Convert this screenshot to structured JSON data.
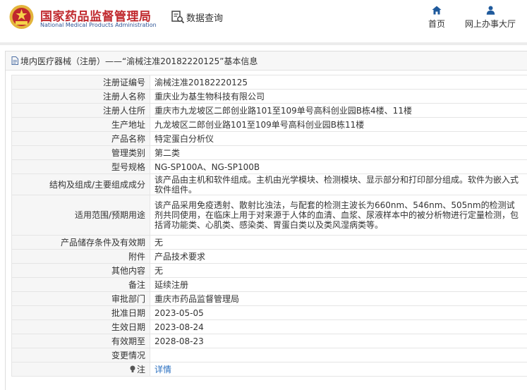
{
  "header": {
    "site_title": "国家药品监督管理局",
    "site_subtitle": "National Medical Products Administration",
    "query_label": "数据查询",
    "nav_home": "首页",
    "nav_online": "网上办事大厅"
  },
  "panel": {
    "title": "境内医疗器械（注册）——“渝械注准20182220125”基本信息"
  },
  "rows": [
    {
      "label": "注册证编号",
      "value": "渝械注准20182220125"
    },
    {
      "label": "注册人名称",
      "value": "重庆业为基生物科技有限公司"
    },
    {
      "label": "注册人住所",
      "value": "重庆市九龙坡区二郎创业路101至109单号高科创业园B栋4楼、11楼"
    },
    {
      "label": "生产地址",
      "value": "九龙坡区二郎创业路101至109单号高科创业园B栋11楼"
    },
    {
      "label": "产品名称",
      "value": "特定蛋白分析仪"
    },
    {
      "label": "管理类别",
      "value": "第二类"
    },
    {
      "label": "型号规格",
      "value": "NG-SP100A、NG-SP100B"
    },
    {
      "label": "结构及组成/主要组成成分",
      "value": "该产品由主机和软件组成。主机由光学模块、检测模块、显示部分和打印部分组成。软件为嵌入式软件组件。"
    },
    {
      "label": "适用范围/预期用途",
      "value": "该产品采用免疫透射、散射比浊法，与配套的检测主波长为660nm、546nm、505nm的检测试剂共同使用，在临床上用于对来源于人体的血清、血浆、尿液样本中的被分析物进行定量检测，包括肾功能类、心肌类、感染类、胃蛋白类以及类风湿病类等。"
    },
    {
      "label": "产品储存条件及有效期",
      "value": "无"
    },
    {
      "label": "附件",
      "value": "产品技术要求"
    },
    {
      "label": "其他内容",
      "value": "无"
    },
    {
      "label": "备注",
      "value": "延续注册"
    },
    {
      "label": "审批部门",
      "value": "重庆市药品监督管理局"
    },
    {
      "label": "批准日期",
      "value": "2023-05-05"
    },
    {
      "label": "生效日期",
      "value": "2023-08-24"
    },
    {
      "label": "有效期至",
      "value": "2028-08-23"
    },
    {
      "label": "变更情况",
      "value": ""
    }
  ],
  "note_row": {
    "label": "注",
    "value": "详情"
  },
  "colors": {
    "brand_red": "#c0282d",
    "brand_blue": "#2f5597",
    "link_blue": "#2a6fc0",
    "label_bg": "#f6f6f6"
  },
  "icons": {
    "logo": "nmpa-emblem-icon",
    "query": "search-document-icon",
    "home": "home-icon",
    "user": "user-icon",
    "panel": "document-icon",
    "note": "lightbulb-icon"
  }
}
